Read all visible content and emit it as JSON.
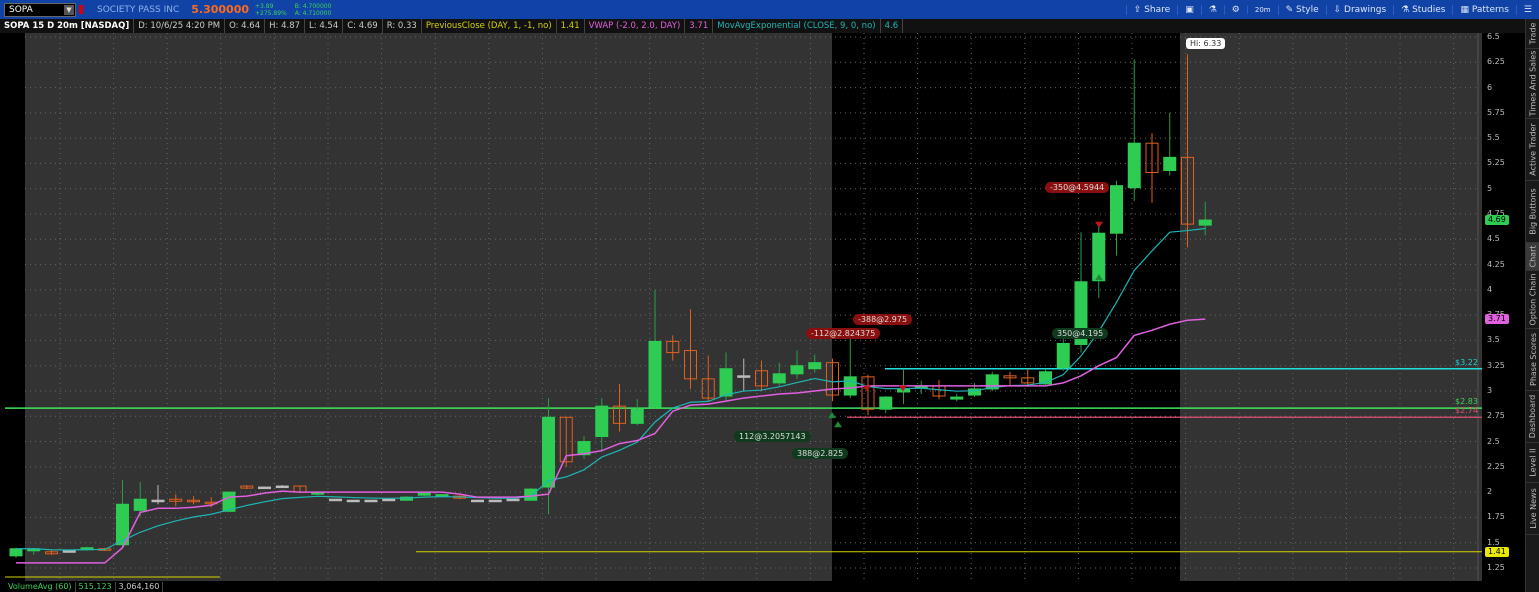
{
  "header": {
    "symbol": "SOPA",
    "company": "SOCIETY PASS INC",
    "last": "5.300000",
    "change": "+3.89",
    "change_pct": "+275.89%",
    "bid": "B: 4.700000",
    "ask": "A: 4.710000"
  },
  "toolbar": {
    "share": "Share",
    "style": "Style",
    "drawings": "Drawings",
    "studies": "Studies",
    "patterns": "Patterns",
    "timeframe": "20m"
  },
  "info": {
    "title": "SOPA 15 D 20m [NASDAQ]",
    "date": "D: 10/6/25 4:20 PM",
    "open": "O: 4.64",
    "high": "H: 4.87",
    "low": "L: 4.54",
    "close": "C: 4.69",
    "range": "R: 0.33",
    "prev_close": "PreviousClose (DAY, 1, -1, no)",
    "prev_close_val": "1.41",
    "vwap": "VWAP (-2.0, 2.0, DAY)",
    "vwap_val": "3.71",
    "ema": "MovAvgExponential (CLOSE, 9, 0, no)",
    "ema_val": "4.6"
  },
  "axis": {
    "ticks": [
      "6.5",
      "6.25",
      "6",
      "5.75",
      "5.5",
      "5.25",
      "5",
      "4.75",
      "4.5",
      "4.25",
      "4",
      "3.75",
      "3.5",
      "3.25",
      "3",
      "2.75",
      "2.5",
      "2.25",
      "2",
      "1.75",
      "1.5",
      "1.25"
    ],
    "last_bubble": "4.69",
    "vwap_bubble": "3.71",
    "prev_bubble": "1.41"
  },
  "levels": {
    "cyan": "$3.22",
    "green": "$2.83",
    "red": "$2.74"
  },
  "hi_label": "Hi: 6.33",
  "trades": {
    "s1": "-112@2.824375",
    "s2": "-388@2.975",
    "b1": "112@3.2057143",
    "b2": "388@2.825",
    "b3": "350@4.195",
    "s3": "-350@4.5944"
  },
  "volume": {
    "label": "VolumeAvg (60)",
    "avg": "515,123",
    "vol": "3,064,160"
  },
  "sidebar": [
    "Trade",
    "Times And Sales",
    "Active Trader",
    "Big Buttons",
    "Chart",
    "Option Chain",
    "Phase Scores",
    "Dashboard",
    "Level II",
    "Live News"
  ],
  "colors": {
    "up": "#2ecc52",
    "down": "#e0601e",
    "ema": "#1fb5b5",
    "vwap": "#e060e0",
    "prev": "#d4d400"
  },
  "chart_data": {
    "type": "candlestick",
    "ylim": [
      1.25,
      6.5
    ],
    "ohlc": [
      [
        1.37,
        1.45,
        1.35,
        1.44
      ],
      [
        1.42,
        1.45,
        1.38,
        1.44
      ],
      [
        1.41,
        1.43,
        1.38,
        1.39
      ],
      [
        1.42,
        1.42,
        1.42,
        1.42
      ],
      [
        1.43,
        1.46,
        1.42,
        1.45
      ],
      [
        1.44,
        1.45,
        1.42,
        1.43
      ],
      [
        1.48,
        2.12,
        1.45,
        1.88
      ],
      [
        1.82,
        2.1,
        1.76,
        1.93
      ],
      [
        1.92,
        2.07,
        1.88,
        1.92
      ],
      [
        1.93,
        1.98,
        1.86,
        1.91
      ],
      [
        1.92,
        1.96,
        1.88,
        1.91
      ],
      [
        1.9,
        1.95,
        1.85,
        1.89
      ],
      [
        1.81,
        2.0,
        1.8,
        2.0
      ],
      [
        2.06,
        2.07,
        2.03,
        2.04
      ],
      [
        2.05,
        2.05,
        2.05,
        2.05
      ],
      [
        2.06,
        2.07,
        2.05,
        2.06
      ],
      [
        2.06,
        2.06,
        1.99,
        2.0
      ],
      [
        1.98,
        2.0,
        1.97,
        2.0
      ],
      [
        1.93,
        1.93,
        1.93,
        1.93
      ],
      [
        1.92,
        1.92,
        1.92,
        1.92
      ],
      [
        1.92,
        1.92,
        1.92,
        1.92
      ],
      [
        1.93,
        1.93,
        1.93,
        1.93
      ],
      [
        1.92,
        1.96,
        1.92,
        1.95
      ],
      [
        1.97,
        1.99,
        1.96,
        1.99
      ],
      [
        1.97,
        1.98,
        1.96,
        1.975
      ],
      [
        1.96,
        1.97,
        1.93,
        1.94
      ],
      [
        1.92,
        1.92,
        1.92,
        1.92
      ],
      [
        1.92,
        1.92,
        1.92,
        1.92
      ],
      [
        1.93,
        1.94,
        1.93,
        1.93
      ],
      [
        1.92,
        2.04,
        1.92,
        2.03
      ],
      [
        2.05,
        2.93,
        1.78,
        2.74
      ],
      [
        2.74,
        2.74,
        2.25,
        2.3
      ],
      [
        2.37,
        2.55,
        2.33,
        2.5
      ],
      [
        2.55,
        2.93,
        2.4,
        2.85
      ],
      [
        2.85,
        3.07,
        2.6,
        2.68
      ],
      [
        2.68,
        2.92,
        2.66,
        2.82
      ],
      [
        2.84,
        4.0,
        2.83,
        3.49
      ],
      [
        3.49,
        3.55,
        3.3,
        3.38
      ],
      [
        3.4,
        3.81,
        3.02,
        3.12
      ],
      [
        3.12,
        3.35,
        2.9,
        2.93
      ],
      [
        2.95,
        3.38,
        2.9,
        3.22
      ],
      [
        3.15,
        3.32,
        3.0,
        3.15
      ],
      [
        3.2,
        3.3,
        3.0,
        3.05
      ],
      [
        3.08,
        3.28,
        3.05,
        3.17
      ],
      [
        3.17,
        3.4,
        3.12,
        3.25
      ],
      [
        3.22,
        3.36,
        3.18,
        3.28
      ],
      [
        3.28,
        3.32,
        2.9,
        2.96
      ],
      [
        2.96,
        3.52,
        2.93,
        3.14
      ],
      [
        3.14,
        3.16,
        2.76,
        2.82
      ],
      [
        2.82,
        2.95,
        2.78,
        2.94
      ],
      [
        2.99,
        3.22,
        2.87,
        3.02
      ],
      [
        3.03,
        3.1,
        2.97,
        3.05
      ],
      [
        3.05,
        3.11,
        2.92,
        2.95
      ],
      [
        2.92,
        2.97,
        2.9,
        2.94
      ],
      [
        2.96,
        3.08,
        2.94,
        3.02
      ],
      [
        3.02,
        3.19,
        3.0,
        3.16
      ],
      [
        3.15,
        3.19,
        3.05,
        3.13
      ],
      [
        3.13,
        3.22,
        3.04,
        3.08
      ],
      [
        3.07,
        3.22,
        3.06,
        3.19
      ],
      [
        3.23,
        3.56,
        3.2,
        3.47
      ],
      [
        3.46,
        4.57,
        3.38,
        4.08
      ],
      [
        4.09,
        4.66,
        3.92,
        4.56
      ],
      [
        4.56,
        5.08,
        4.34,
        5.03
      ],
      [
        5.01,
        6.28,
        4.88,
        5.45
      ],
      [
        5.45,
        5.55,
        4.86,
        5.16
      ],
      [
        5.18,
        5.75,
        5.13,
        5.31
      ],
      [
        5.31,
        6.33,
        4.42,
        4.65
      ],
      [
        4.64,
        4.87,
        4.54,
        4.69
      ]
    ],
    "vwap": [
      1.3,
      1.3,
      1.3,
      1.3,
      1.3,
      1.3,
      1.45,
      1.8,
      1.84,
      1.84,
      1.85,
      1.87,
      1.95,
      1.96,
      1.99,
      2.01,
      2.0,
      2.0,
      2.0,
      2.0,
      2.0,
      2.0,
      2.0,
      2.0,
      2.0,
      1.98,
      1.95,
      1.95,
      1.95,
      1.96,
      1.98,
      2.36,
      2.38,
      2.41,
      2.48,
      2.51,
      2.58,
      2.8,
      2.86,
      2.87,
      2.9,
      2.93,
      2.95,
      2.97,
      2.98,
      3.0,
      3.02,
      3.03,
      3.05,
      3.05,
      3.05,
      3.05,
      3.05,
      3.05,
      3.05,
      3.05,
      3.05,
      3.05,
      3.05,
      3.08,
      3.15,
      3.25,
      3.33,
      3.55,
      3.6,
      3.66,
      3.7,
      3.71
    ],
    "levels": {
      "prev_close": 1.41,
      "cyan": 3.22,
      "green": 2.83,
      "red": 2.74
    }
  }
}
